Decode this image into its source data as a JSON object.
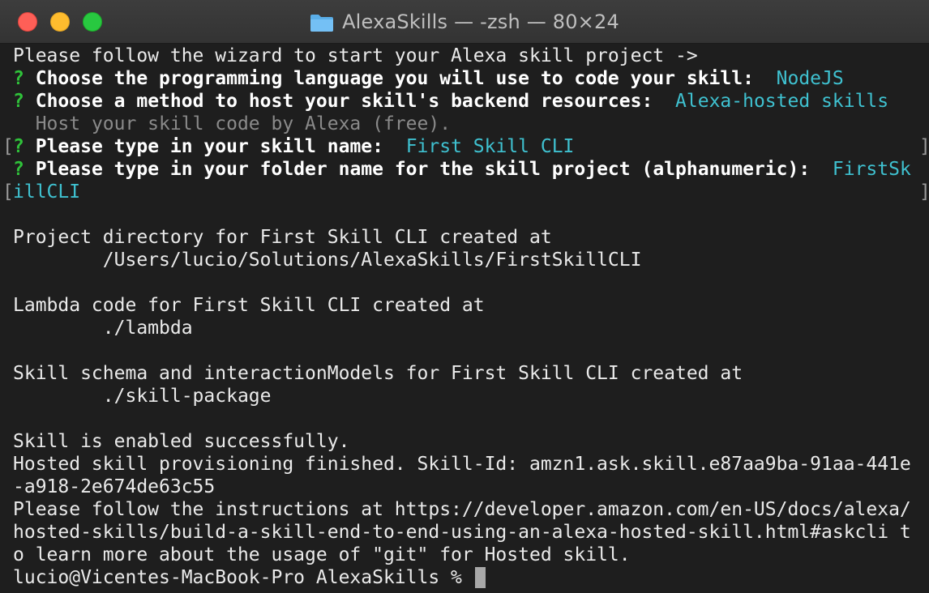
{
  "window": {
    "title": "AlexaSkills — -zsh — 80×24",
    "folder_icon": "folder-icon",
    "controls": [
      "close",
      "minimize",
      "zoom"
    ]
  },
  "colors": {
    "background": "#1e1e1e",
    "prompt_marker": "#2fc23a",
    "answer": "#3fc1d0",
    "hint": "#8a8a8a"
  },
  "terminal": {
    "intro": "Please follow the wizard to start your Alexa skill project ->",
    "q1": {
      "marker": "?",
      "question": "Choose the programming language you will use to code your skill:",
      "answer": "NodeJS"
    },
    "q2": {
      "marker": "?",
      "question": "Choose a method to host your skill's backend resources:",
      "answer": "Alexa-hosted skills"
    },
    "q2_hint": "Host your skill code by Alexa (free).",
    "q3": {
      "marker": "?",
      "question": "Please type in your skill name:",
      "answer": "First Skill CLI"
    },
    "q4": {
      "marker": "?",
      "question": "Please type in your folder name for the skill project (alphanumeric):",
      "answer_part1": "FirstSk",
      "answer_part2": "illCLI"
    },
    "open_bracket": "[",
    "close_bracket": "]",
    "project_dir": "Project directory for First Skill CLI created at",
    "project_path": "        /Users/lucio/Solutions/AlexaSkills/FirstSkillCLI",
    "lambda_line": "Lambda code for First Skill CLI created at",
    "lambda_path": "        ./lambda",
    "schema_line": "Skill schema and interactionModels for First Skill CLI created at",
    "schema_path": "        ./skill-package",
    "enabled": "Skill is enabled successfully.",
    "hosted_1": "Hosted skill provisioning finished. Skill-Id: amzn1.ask.skill.e87aa9ba-91aa-441e",
    "hosted_2": "-a918-2e674de63c55",
    "follow_1": "Please follow the instructions at https://developer.amazon.com/en-US/docs/alexa/",
    "follow_2": "hosted-skills/build-a-skill-end-to-end-using-an-alexa-hosted-skill.html#askcli t",
    "follow_3": "o learn more about the usage of \"git\" for Hosted skill.",
    "prompt": "lucio@Vicentes-MacBook-Pro AlexaSkills % "
  }
}
